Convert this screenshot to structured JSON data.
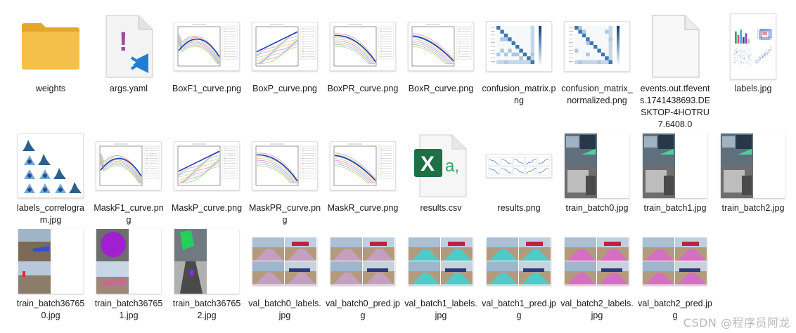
{
  "files": [
    {
      "name": "weights",
      "kind": "folder"
    },
    {
      "name": "args.yaml",
      "kind": "yaml"
    },
    {
      "name": "BoxF1_curve.png",
      "kind": "f1plot"
    },
    {
      "name": "BoxP_curve.png",
      "kind": "pplot"
    },
    {
      "name": "BoxPR_curve.png",
      "kind": "prplot"
    },
    {
      "name": "BoxR_curve.png",
      "kind": "rplot"
    },
    {
      "name": "confusion_matrix.png",
      "kind": "confusion"
    },
    {
      "name": "confusion_matrix_normalized.png",
      "kind": "confusion"
    },
    {
      "name": "events.out.tfevents.1741438693.DESKTOP-4HOTRU7.6408.0",
      "kind": "blank"
    },
    {
      "name": "labels.jpg",
      "kind": "labels"
    },
    {
      "name": "labels_correlogram.jpg",
      "kind": "correlogram"
    },
    {
      "name": "MaskF1_curve.png",
      "kind": "f1plot"
    },
    {
      "name": "MaskP_curve.png",
      "kind": "pplot"
    },
    {
      "name": "MaskPR_curve.png",
      "kind": "prplot"
    },
    {
      "name": "MaskR_curve.png",
      "kind": "rplot"
    },
    {
      "name": "results.csv",
      "kind": "excel"
    },
    {
      "name": "results.png",
      "kind": "results"
    },
    {
      "name": "train_batch0.jpg",
      "kind": "trainbatch"
    },
    {
      "name": "train_batch1.jpg",
      "kind": "trainbatch"
    },
    {
      "name": "train_batch2.jpg",
      "kind": "trainbatch"
    },
    {
      "name": "train_batch367650.jpg",
      "kind": "trainbatchB"
    },
    {
      "name": "train_batch367651.jpg",
      "kind": "trainbatchP"
    },
    {
      "name": "train_batch367652.jpg",
      "kind": "trainbatchG"
    },
    {
      "name": "val_batch0_labels.jpg",
      "kind": "valbatch"
    },
    {
      "name": "val_batch0_pred.jpg",
      "kind": "valbatch"
    },
    {
      "name": "val_batch1_labels.jpg",
      "kind": "valbatchC"
    },
    {
      "name": "val_batch1_pred.jpg",
      "kind": "valbatchC"
    },
    {
      "name": "val_batch2_labels.jpg",
      "kind": "valbatchM"
    },
    {
      "name": "val_batch2_pred.jpg",
      "kind": "valbatchM"
    }
  ],
  "watermark": "CSDN @程序员阿龙",
  "colors": {
    "folder": "#f5c04a",
    "folder_dark": "#e2a62b",
    "yaml_mark": "#9b4f96",
    "vscode_blue": "#1f7ed4",
    "excel_green": "#1d7044",
    "excel_light": "#33a36b"
  }
}
